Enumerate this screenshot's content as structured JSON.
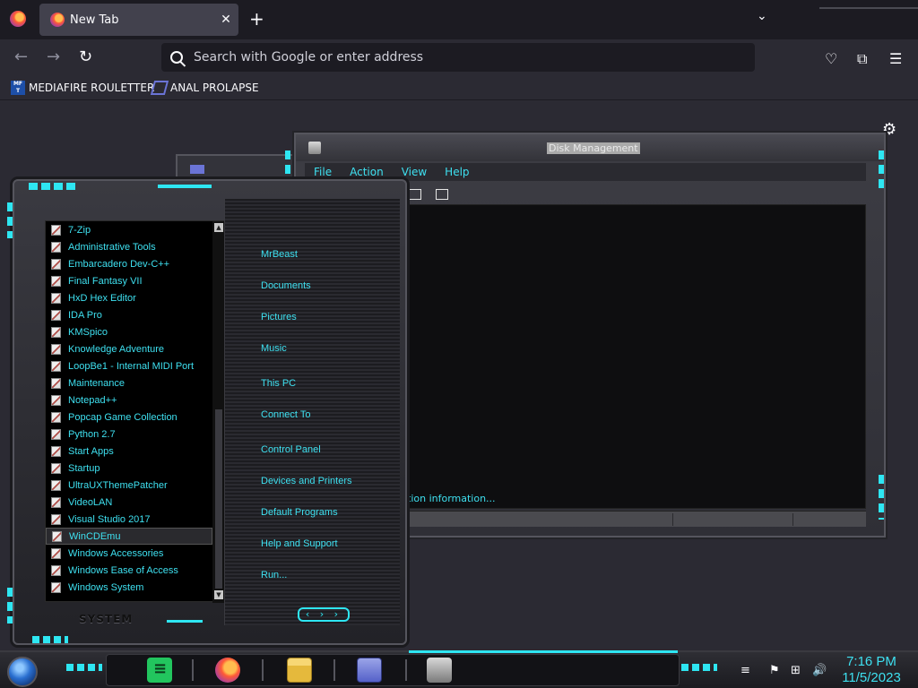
{
  "browser": {
    "tab": {
      "title": "New Tab",
      "close": "✕"
    },
    "new_tab_symbol": "+",
    "tab_list_symbol": "⌄",
    "nav": {
      "back": "←",
      "forward": "→",
      "reload": "↻"
    },
    "url_placeholder": "Search with Google or enter address",
    "toolbar_icons": [
      "pocket-icon",
      "extensions-icon",
      "menu-icon"
    ],
    "bookmarks": [
      {
        "label": "MEDIAFIRE ROULETTER",
        "icon_text": "MF T"
      },
      {
        "label": "ANAL PROLAPSE"
      }
    ]
  },
  "disk_window": {
    "title": "Disk Management",
    "menus": [
      "File",
      "Action",
      "View",
      "Help"
    ],
    "status_text": "tion information..."
  },
  "start_menu": {
    "programs": [
      "7-Zip",
      "Administrative Tools",
      "Embarcadero Dev-C++",
      "Final Fantasy VII",
      "HxD Hex Editor",
      "IDA Pro",
      "KMSpico",
      "Knowledge Adventure",
      "LoopBe1 - Internal MIDI Port",
      "Maintenance",
      "Notepad++",
      "Popcap Game Collection",
      "Python 2.7",
      "Start Apps",
      "Startup",
      "UltraUXThemePatcher",
      "VideoLAN",
      "Visual Studio 2017",
      "WinCDEmu",
      "Windows Accessories",
      "Windows Ease of Access",
      "Windows System"
    ],
    "selected_program": "WinCDEmu",
    "links": [
      "MrBeast",
      "Documents",
      "Pictures",
      "Music",
      "This PC",
      "Connect To",
      "Control Panel",
      "Devices and Printers",
      "Default Programs",
      "Help and Support",
      "Run..."
    ],
    "system_label": "SYSTEM",
    "nav_arrows": "‹ › ›"
  },
  "taskbar": {
    "time": "7:16 PM",
    "date": "11/5/2023",
    "apps": [
      "notes-app",
      "firefox-app",
      "file-explorer-app",
      "disk-management-app",
      "installer-app"
    ]
  },
  "colors": {
    "accent_cyan": "#2ee6f2",
    "text_cyan": "#3ee0f0",
    "browser_bg": "#2b2a33",
    "tabbar_bg": "#1c1b22"
  }
}
